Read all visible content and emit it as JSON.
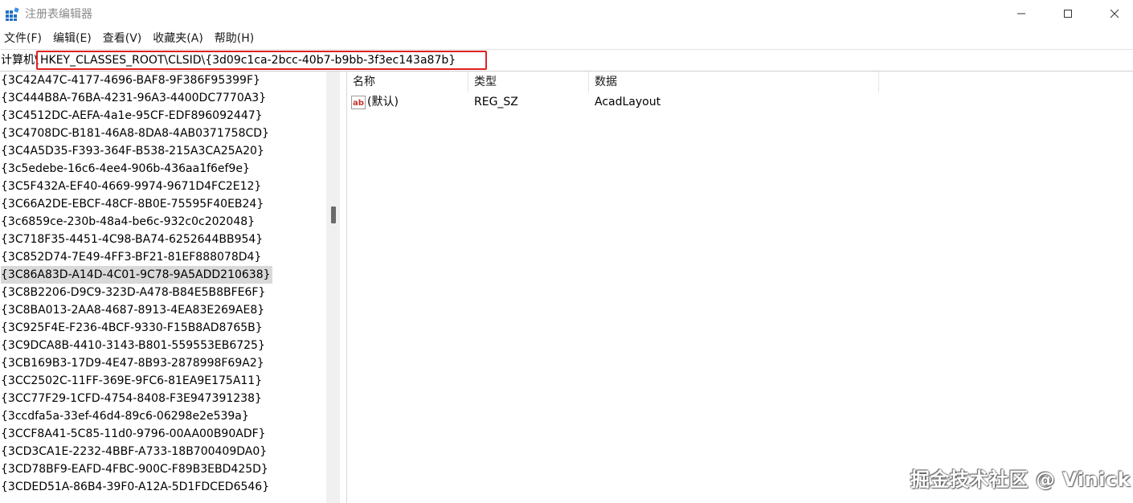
{
  "window": {
    "title": "注册表编辑器",
    "minimize_icon": "minimize-icon",
    "maximize_icon": "maximize-icon",
    "close_icon": "close-icon"
  },
  "menu": {
    "items": [
      {
        "label": "文件(F)"
      },
      {
        "label": "编辑(E)"
      },
      {
        "label": "查看(V)"
      },
      {
        "label": "收藏夹(A)"
      },
      {
        "label": "帮助(H)"
      }
    ]
  },
  "address": {
    "prefix": "计算机\\",
    "path": "HKEY_CLASSES_ROOT\\CLSID\\{3d09c1ca-2bcc-40b7-b9bb-3f3ec143a87b}",
    "highlight_color": "#e02020"
  },
  "tree": {
    "items": [
      "{3C42A47C-4177-4696-BAF8-9F386F95399F}",
      "{3C444B8A-76BA-4231-96A3-4400DC7770A3}",
      "{3C4512DC-AEFA-4a1e-95CF-EDF896092447}",
      "{3C4708DC-B181-46A8-8DA8-4AB0371758CD}",
      "{3C4A5D35-F393-364F-B538-215A3CA25A20}",
      "{3c5edebe-16c6-4ee4-906b-436aa1f6ef9e}",
      "{3C5F432A-EF40-4669-9974-9671D4FC2E12}",
      "{3C66A2DE-EBCF-48CF-8B0E-75595F40EB24}",
      "{3c6859ce-230b-48a4-be6c-932c0c202048}",
      "{3C718F35-4451-4C98-BA74-6252644BB954}",
      "{3C852D74-7E49-4FF3-BF21-81EF888078D4}",
      "{3C86A83D-A14D-4C01-9C78-9A5ADD210638}",
      "{3C8B2206-D9C9-323D-A478-B84E5B8BFE6F}",
      "{3C8BA013-2AA8-4687-8913-4EA83E269AE8}",
      "{3C925F4E-F236-4BCF-9330-F15B8AD8765B}",
      "{3C9DCA8B-4410-3143-B801-559553EB6725}",
      "{3CB169B3-17D9-4E47-8B93-2878998F69A2}",
      "{3CC2502C-11FF-369E-9FC6-81EA9E175A11}",
      "{3CC77F29-1CFD-4754-8408-F3E947391238}",
      "{3ccdfa5a-33ef-46d4-89c6-06298e2e539a}",
      "{3CCF8A41-5C85-11d0-9796-00AA00B90ADF}",
      "{3CD3CA1E-2232-4BBF-A733-18B700409DA0}",
      "{3CD78BF9-EAFD-4FBC-900C-F89B3EBD425D}",
      "{3CDED51A-86B4-39F0-A12A-5D1FDCED6546}"
    ],
    "selected_index": 11
  },
  "list": {
    "headers": {
      "name": "名称",
      "type": "类型",
      "data": "数据"
    },
    "rows": [
      {
        "icon": "string-value-icon",
        "name": "(默认)",
        "type": "REG_SZ",
        "data": "AcadLayout"
      }
    ]
  },
  "watermark": "掘金技术社区 @ Vinick"
}
